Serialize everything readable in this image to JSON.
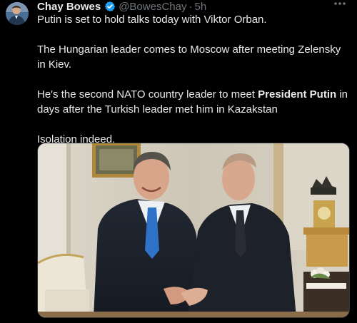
{
  "tweet": {
    "author_name": "Chay Bowes",
    "handle": "@BowesChay",
    "separator": "·",
    "timestamp": "5h",
    "paragraphs": [
      "Putin is set to hold talks today with Viktor Orban.",
      "The Hungarian leader comes to Moscow after meeting Zelensky in Kiev."
    ],
    "para3_before": "He's the second NATO country leader to meet ",
    "para3_bold": "President Putin",
    "para3_after": " in days after the Turkish leader met him in Kazakstan",
    "para4": "Isolation indeed."
  },
  "icons": {
    "verified": "verified-badge-icon",
    "more": "more-options-icon"
  },
  "colors": {
    "background": "#000000",
    "text": "#e7e9ea",
    "secondary_text": "#71767b",
    "verified_blue": "#1d9bf0"
  }
}
